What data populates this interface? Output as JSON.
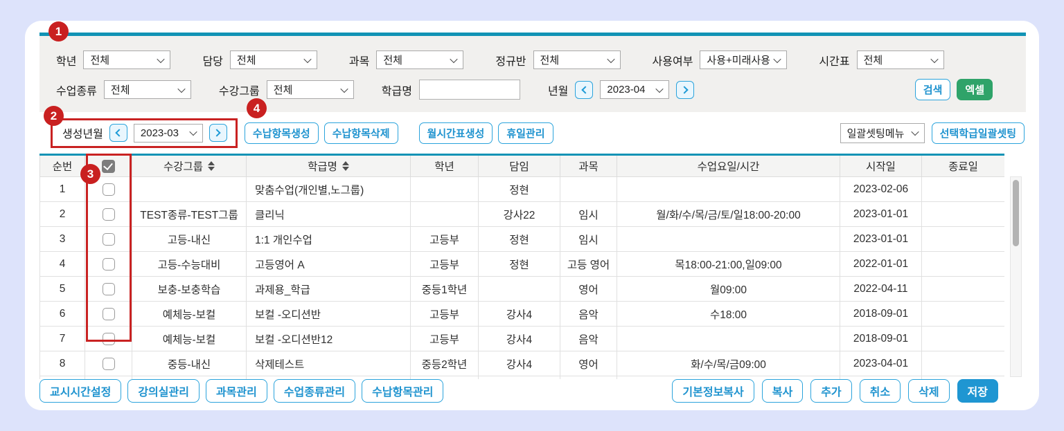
{
  "colors": {
    "accent_teal": "#1193b5",
    "button_blue": "#2aa3dc",
    "excel_green": "#2fa369",
    "save_blue": "#1f96d2",
    "annotation_red": "#c92222",
    "page_background": "#dde3fb"
  },
  "badges": {
    "one": "1",
    "two": "2",
    "three": "3",
    "four": "4"
  },
  "filters": {
    "row1": [
      {
        "label": "학년",
        "value": "전체"
      },
      {
        "label": "담당",
        "value": "전체"
      },
      {
        "label": "과목",
        "value": "전체"
      },
      {
        "label": "정규반",
        "value": "전체"
      },
      {
        "label": "사용여부",
        "value": "사용+미래사용"
      },
      {
        "label": "시간표",
        "value": "전체"
      }
    ],
    "row2": {
      "class_type_label": "수업종류",
      "class_type_value": "전체",
      "group_label": "수강그룹",
      "group_value": "전체",
      "class_name_label": "학급명",
      "class_name_value": "",
      "month_label": "년월",
      "month_value": "2023-04"
    },
    "search_label": "검색",
    "excel_label": "엑셀"
  },
  "generation": {
    "label": "생성년월",
    "month_value": "2023-03",
    "create_fee_label": "수납항목생성",
    "delete_fee_label": "수납항목삭제",
    "monthly_timetable_label": "월시간표생성",
    "holiday_label": "휴일관리",
    "batch_menu_value": "일괄셋팅메뉴",
    "batch_apply_label": "선택학급일괄셋팅"
  },
  "table": {
    "headers": {
      "no": "순번",
      "group": "수강그룹",
      "class_name": "학급명",
      "grade": "학년",
      "teacher": "담임",
      "subject": "과목",
      "schedule": "수업요일/시간",
      "start": "시작일",
      "end": "종료일"
    },
    "rows": [
      {
        "no": "1",
        "group": "",
        "class_name": "맞춤수업(개인별,노그룹)",
        "grade": "",
        "teacher": "정현",
        "subject": "",
        "schedule": "",
        "start": "2023-02-06",
        "end": ""
      },
      {
        "no": "2",
        "group": "TEST종류-TEST그룹",
        "class_name": "클리닉",
        "grade": "",
        "teacher": "강사22",
        "subject": "임시",
        "schedule": "월/화/수/목/금/토/일18:00-20:00",
        "start": "2023-01-01",
        "end": ""
      },
      {
        "no": "3",
        "group": "고등-내신",
        "class_name": "1:1 개인수업",
        "grade": "고등부",
        "teacher": "정현",
        "subject": "임시",
        "schedule": "",
        "start": "2023-01-01",
        "end": ""
      },
      {
        "no": "4",
        "group": "고등-수능대비",
        "class_name": "고등영어 A",
        "grade": "고등부",
        "teacher": "정현",
        "subject": "고등 영어",
        "schedule": "목18:00-21:00,일09:00",
        "start": "2022-01-01",
        "end": ""
      },
      {
        "no": "5",
        "group": "보충-보충학습",
        "class_name": "과제용_학급",
        "grade": "중등1학년",
        "teacher": "",
        "subject": "영어",
        "schedule": "월09:00",
        "start": "2022-04-11",
        "end": ""
      },
      {
        "no": "6",
        "group": "예체능-보컬",
        "class_name": "보컬 -오디션반",
        "grade": "고등부",
        "teacher": "강사4",
        "subject": "음악",
        "schedule": "수18:00",
        "start": "2018-09-01",
        "end": ""
      },
      {
        "no": "7",
        "group": "예체능-보컬",
        "class_name": "보컬 -오디션반12",
        "grade": "고등부",
        "teacher": "강사4",
        "subject": "음악",
        "schedule": "",
        "start": "2018-09-01",
        "end": ""
      },
      {
        "no": "8",
        "group": "중등-내신",
        "class_name": "삭제테스트",
        "grade": "중등2학년",
        "teacher": "강사4",
        "subject": "영어",
        "schedule": "화/수/목/금09:00",
        "start": "2023-04-01",
        "end": ""
      }
    ]
  },
  "footer": {
    "left_buttons": [
      "교시시간설정",
      "강의실관리",
      "과목관리",
      "수업종류관리",
      "수납항목관리"
    ],
    "right_buttons": [
      "기본정보복사",
      "복사",
      "추가",
      "취소",
      "삭제"
    ],
    "save_label": "저장"
  }
}
